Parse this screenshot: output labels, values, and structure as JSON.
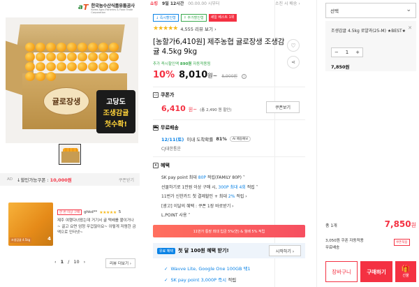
{
  "seller_logo": {
    "name_ko": "한국농수산식품유통공사",
    "name_en": "Korea Agro-Fisheries & Food Trade Corporation"
  },
  "product_image": {
    "brand_text": "귤로장생",
    "label_line1": "고당도",
    "label_line2": "조생감귤",
    "label_line3": "첫수확!"
  },
  "left": {
    "ad_label": "AD",
    "coupon_prefix": "↓할인가능쿠폰 :",
    "coupon_amount": "10,000원",
    "coupon_download": "쿠폰받기",
    "review": {
      "badge": "한 번 이상 구매",
      "user": "ghkd**",
      "stars": "★★★★★",
      "score": "5",
      "body": "제주 여행다녀왔는데 거기서 귤 택배를 붙이거나~ 골고 요면 엄청 무겁잖아요~ 이렇게 저렴한 금액으로 인터넷~",
      "photo_count": "4",
      "photo_tag": "조생감귤 4.5kg"
    },
    "pager": {
      "prev": "‹",
      "current": "1",
      "sep": "/",
      "total": "10",
      "next": "›"
    },
    "more_reviews": "리뷰 더보기 ›"
  },
  "top": {
    "brand": "쇼킹",
    "ship_time": "9일 12시간",
    "muted": "00.00.00 시부터",
    "right": "소진 시 배송 ›"
  },
  "badges": [
    "↓ 즉시할인형",
    "↑ 추가할인형",
    "세일 베스트 1위"
  ],
  "rating": {
    "stars": "★★★★★",
    "count": "4,555 리뷰 보기 ›"
  },
  "title": "[농할가6,410원] 제주농협 귤로장생 조생감귤 4.5kg 9kg",
  "promo_line_prefix": "추가 즉시할인액",
  "promo_line_amount": "890원",
  "promo_line_suffix": "자동적용됨",
  "price": {
    "rate": "10%",
    "value": "8,010",
    "won": "원~",
    "original": "8,900원"
  },
  "coupon": {
    "title": "쿠폰가",
    "price": "6,410",
    "won": "원~",
    "note": "(총 2,490 원 할인)",
    "button": "쿠폰보기"
  },
  "shipping": {
    "title": "무료배송",
    "date": "12/11(토)",
    "text": "이내 도착확률",
    "pct": "81%",
    "ai_tag": "AI 배송예보",
    "company": "CJ대한통운"
  },
  "benefits": {
    "title": "혜택",
    "lines": [
      {
        "prefix": "SK pay point 최대",
        "blue": "80P",
        "suffix": "적립(FAMILY 80P) ˅"
      },
      {
        "prefix": "선물하기로 1만원 이상 구매 시,",
        "blue": "300P 최대 4회",
        "suffix": "적립 ˅"
      },
      {
        "prefix": "11번가 신한카드 첫 결제할인 + 최대",
        "blue": "2%",
        "suffix": "적립 ›"
      },
      {
        "prefix": "[광고] 이달의 혜택 : 쿠폰 1장 바로받기 ›",
        "blue": "",
        "suffix": ""
      },
      {
        "prefix": "L.POINT 사용 ˅",
        "blue": "",
        "suffix": ""
      }
    ]
  },
  "event_banner": "11번가 통장 최대 입금 5%(연) & 월배 5% 적립",
  "first_buy": {
    "badge": "유료 혜택",
    "text": "첫 달 100원 혜택 받기!",
    "button": "시작하기 ›"
  },
  "perks": [
    {
      "check": "✓",
      "text": "Wavve Lite, Google One 100GB 택1",
      "blue": ""
    },
    {
      "check": "✓",
      "text": "적립",
      "blue": "SK pay point 3,000P 즉시"
    }
  ],
  "order": {
    "select_label": "선택",
    "option_name": "조생감귤 4.5kg 로얄과(25-M) ★BEST★",
    "qty": "1",
    "minus": "−",
    "plus": "+",
    "subtotal": "7,850원",
    "total_label": "총 1개",
    "total": "7,850",
    "total_won": "원",
    "points_line": "3,050원 쿠폰 자동적용",
    "shipping_line": "무료배송",
    "coupon_apply": "쿠폰적용",
    "cart": "장바구니",
    "buy": "구매하기",
    "gift": "선물"
  },
  "colors": {
    "accent": "#f43142",
    "blue": "#0b83e6",
    "green": "#39a94d"
  }
}
